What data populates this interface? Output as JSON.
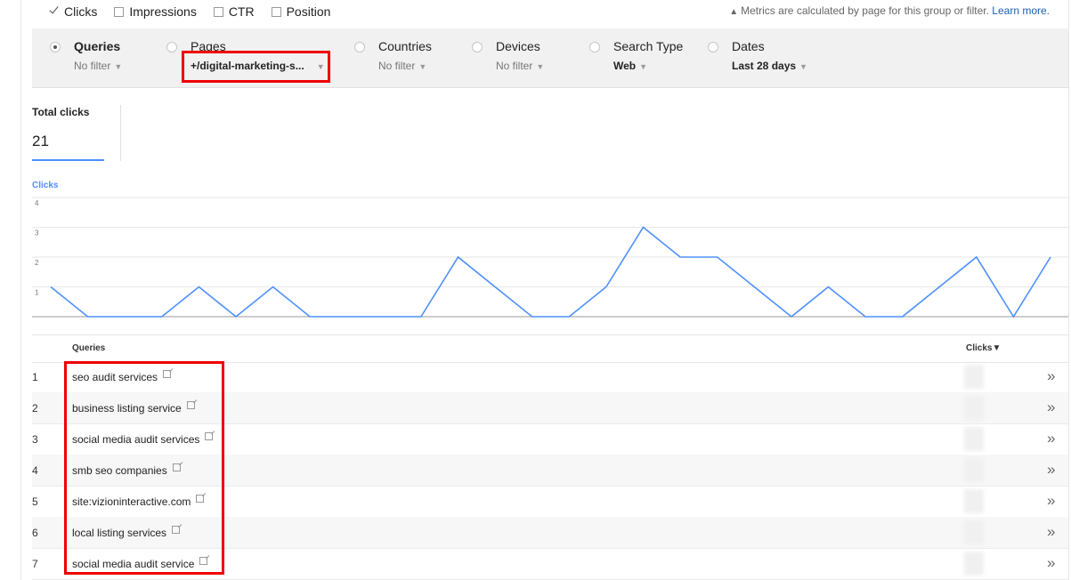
{
  "metrics": [
    {
      "label": "Clicks",
      "checked": true
    },
    {
      "label": "Impressions",
      "checked": false
    },
    {
      "label": "CTR",
      "checked": false
    },
    {
      "label": "Position",
      "checked": false
    }
  ],
  "note": {
    "text": "Metrics are calculated by page for this group or filter.",
    "link": "Learn more."
  },
  "groups": [
    {
      "label": "Queries",
      "filter": "No filter",
      "selected": true
    },
    {
      "label": "Pages",
      "filter": "+/digital-marketing-s...",
      "selected": false
    },
    {
      "label": "Countries",
      "filter": "No filter",
      "selected": false
    },
    {
      "label": "Devices",
      "filter": "No filter",
      "selected": false
    },
    {
      "label": "Search Type",
      "filter": "Web",
      "selected": false
    },
    {
      "label": "Dates",
      "filter": "Last 28 days",
      "selected": false
    }
  ],
  "total": {
    "label": "Total clicks",
    "value": "21"
  },
  "chart_data": {
    "type": "line",
    "series": [
      {
        "name": "Clicks",
        "color": "#4d90fe",
        "values": [
          1,
          0,
          0,
          0,
          1,
          0,
          1,
          0,
          0,
          0,
          0,
          2,
          1,
          0,
          0,
          1,
          3,
          2,
          2,
          1,
          0,
          1,
          0,
          0,
          1,
          2,
          0,
          2
        ]
      }
    ],
    "y_ticks": [
      "4",
      "3",
      "2",
      "1"
    ],
    "ylim": [
      0,
      4
    ],
    "grid": true
  },
  "table": {
    "headers": {
      "query": "Queries",
      "clicks": "Clicks▼"
    },
    "rows": [
      {
        "num": "1",
        "query": "seo audit services"
      },
      {
        "num": "2",
        "query": "business listing service"
      },
      {
        "num": "3",
        "query": "social media audit services"
      },
      {
        "num": "4",
        "query": "smb seo companies"
      },
      {
        "num": "5",
        "query": "site:vizioninteractive.com"
      },
      {
        "num": "6",
        "query": "local listing services"
      },
      {
        "num": "7",
        "query": "social media audit service"
      }
    ],
    "row_action": "»"
  }
}
